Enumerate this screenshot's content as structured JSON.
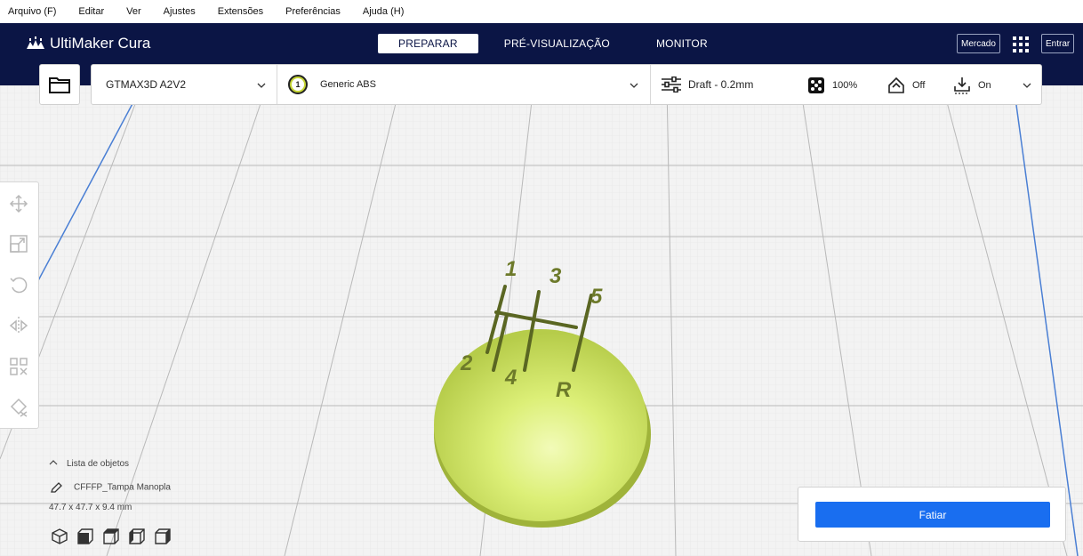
{
  "menu": [
    {
      "label": "Arquivo (F)"
    },
    {
      "label": "Editar"
    },
    {
      "label": "Ver"
    },
    {
      "label": "Ajustes"
    },
    {
      "label": "Extensões"
    },
    {
      "label": "Preferências"
    },
    {
      "label": "Ajuda (H)"
    }
  ],
  "header": {
    "logo_text": "UltiMaker Cura",
    "tabs": [
      {
        "label": "PREPARAR",
        "active": true
      },
      {
        "label": "PRÉ-VISUALIZAÇÃO",
        "active": false
      },
      {
        "label": "MONITOR",
        "active": false
      }
    ],
    "marketplace_label": "Mercado",
    "signin_label": "Entrar",
    "bg_color": "#0b1545"
  },
  "toolbar": {
    "printer": "GTMAX3D A2V2",
    "extruder_number": "1",
    "material": "Generic ABS",
    "profile": "Draft - 0.2mm",
    "infill": "100%",
    "support": "Off",
    "adhesion": "On"
  },
  "objects": {
    "header": "Lista de objetos",
    "object_name": "CFFFP_Tampa Manopla",
    "dimensions": "47.7 x 47.7 x 9.4 mm"
  },
  "model": {
    "color": "#d4ec6a",
    "engraved_labels": [
      "1",
      "3",
      "5",
      "2",
      "4",
      "R"
    ]
  },
  "slice": {
    "button_label": "Fatiar",
    "accent_color": "#196ef0"
  }
}
